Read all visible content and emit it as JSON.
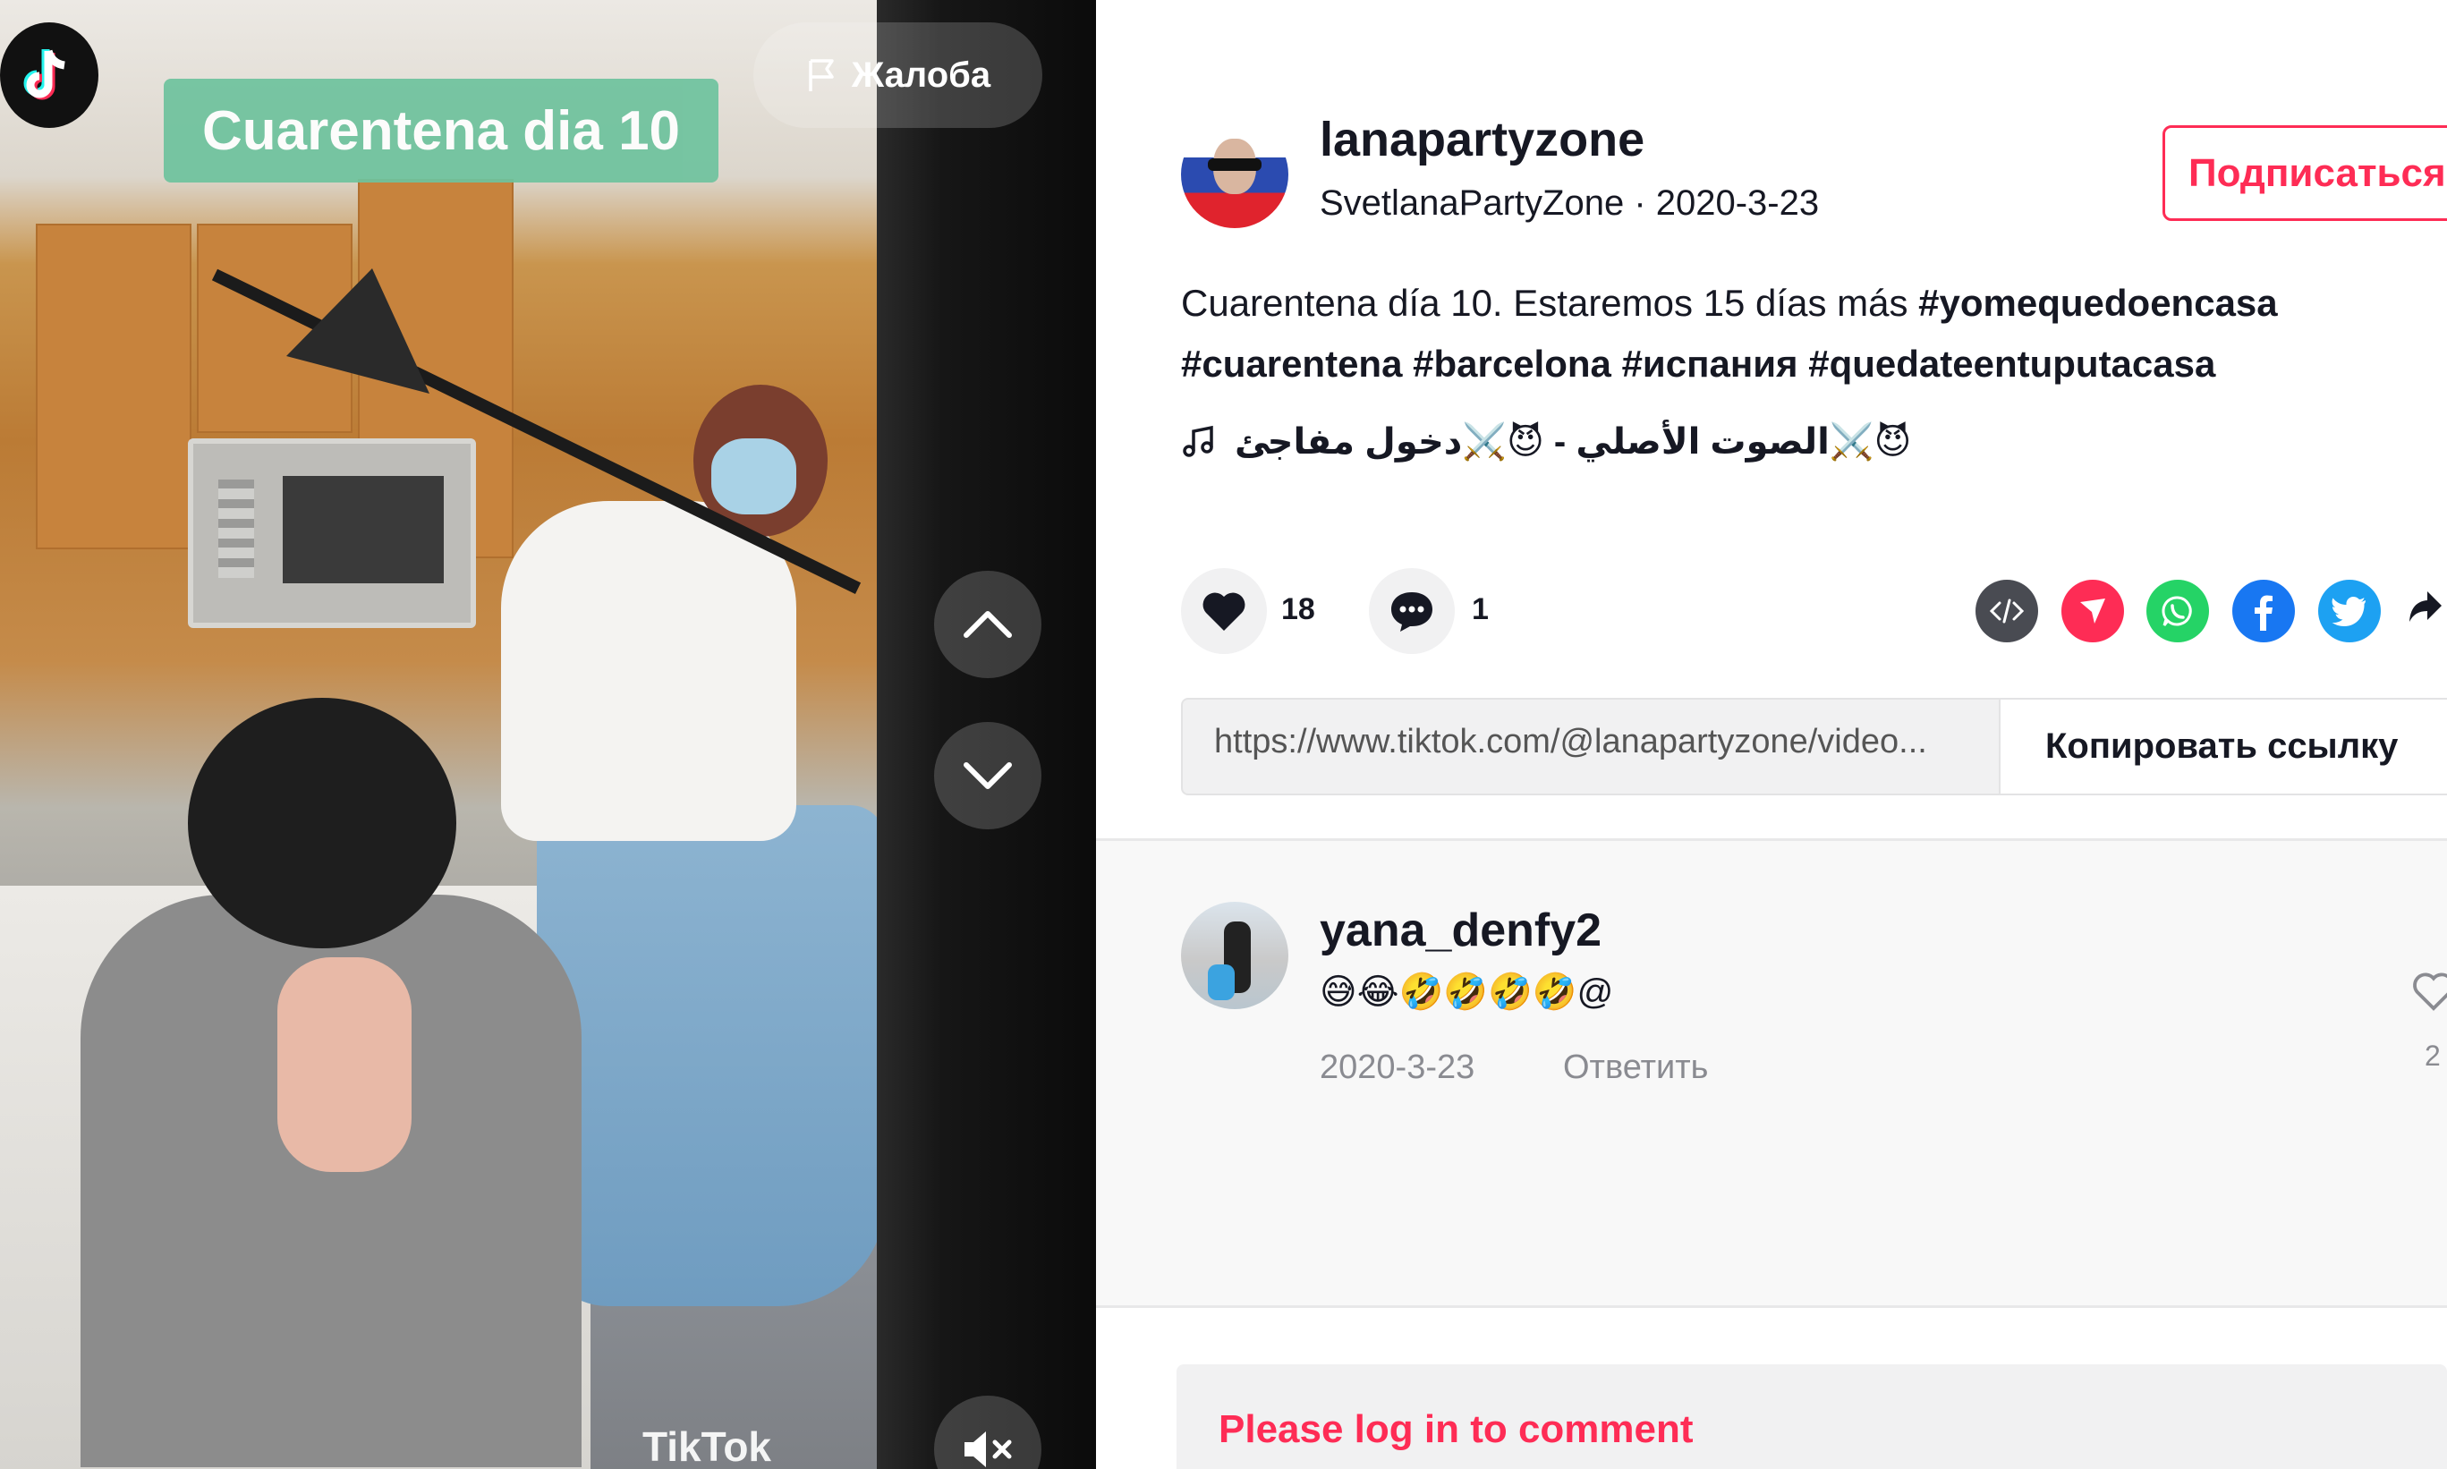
{
  "video": {
    "caption": "Cuarentena dia 10",
    "report_label": "Жалоба",
    "watermark": "TikTok"
  },
  "author": {
    "username": "lanapartyzone",
    "nickname": "SvetlanaPartyZone",
    "separator": " · ",
    "date": "2020-3-23",
    "follow_label": "Подписаться"
  },
  "post": {
    "description_text": "Cuarentena día 10. Estaremos 15 días más ",
    "hashtags": [
      "#yomequedoencasa",
      "#cuarentena",
      "#barcelona",
      "#испания",
      "#quedateentuputacasa"
    ],
    "music": "😈⚔️الصوت الأصلي - 😈⚔️دخول مفاجئ"
  },
  "stats": {
    "likes": "18",
    "comments": "1"
  },
  "share_icons": [
    "embed-icon",
    "send-icon",
    "whatsapp-icon",
    "facebook-icon",
    "twitter-icon",
    "share-arrow-icon"
  ],
  "link": {
    "url": "https://www.tiktok.com/@lanapartyzone/video...",
    "copy_label": "Копировать ссылку"
  },
  "comment": {
    "username": "yana_denfy2",
    "text": "😅😂🤣🤣🤣🤣@",
    "date": "2020-3-23",
    "reply_label": "Ответить",
    "like_count": "2"
  },
  "login": {
    "prompt": "Please log in to comment"
  },
  "colors": {
    "accent": "#fe2c55",
    "caption_bg": "#6fc39e",
    "whatsapp": "#25d366",
    "facebook": "#1877f2",
    "twitter": "#1da1f2"
  }
}
